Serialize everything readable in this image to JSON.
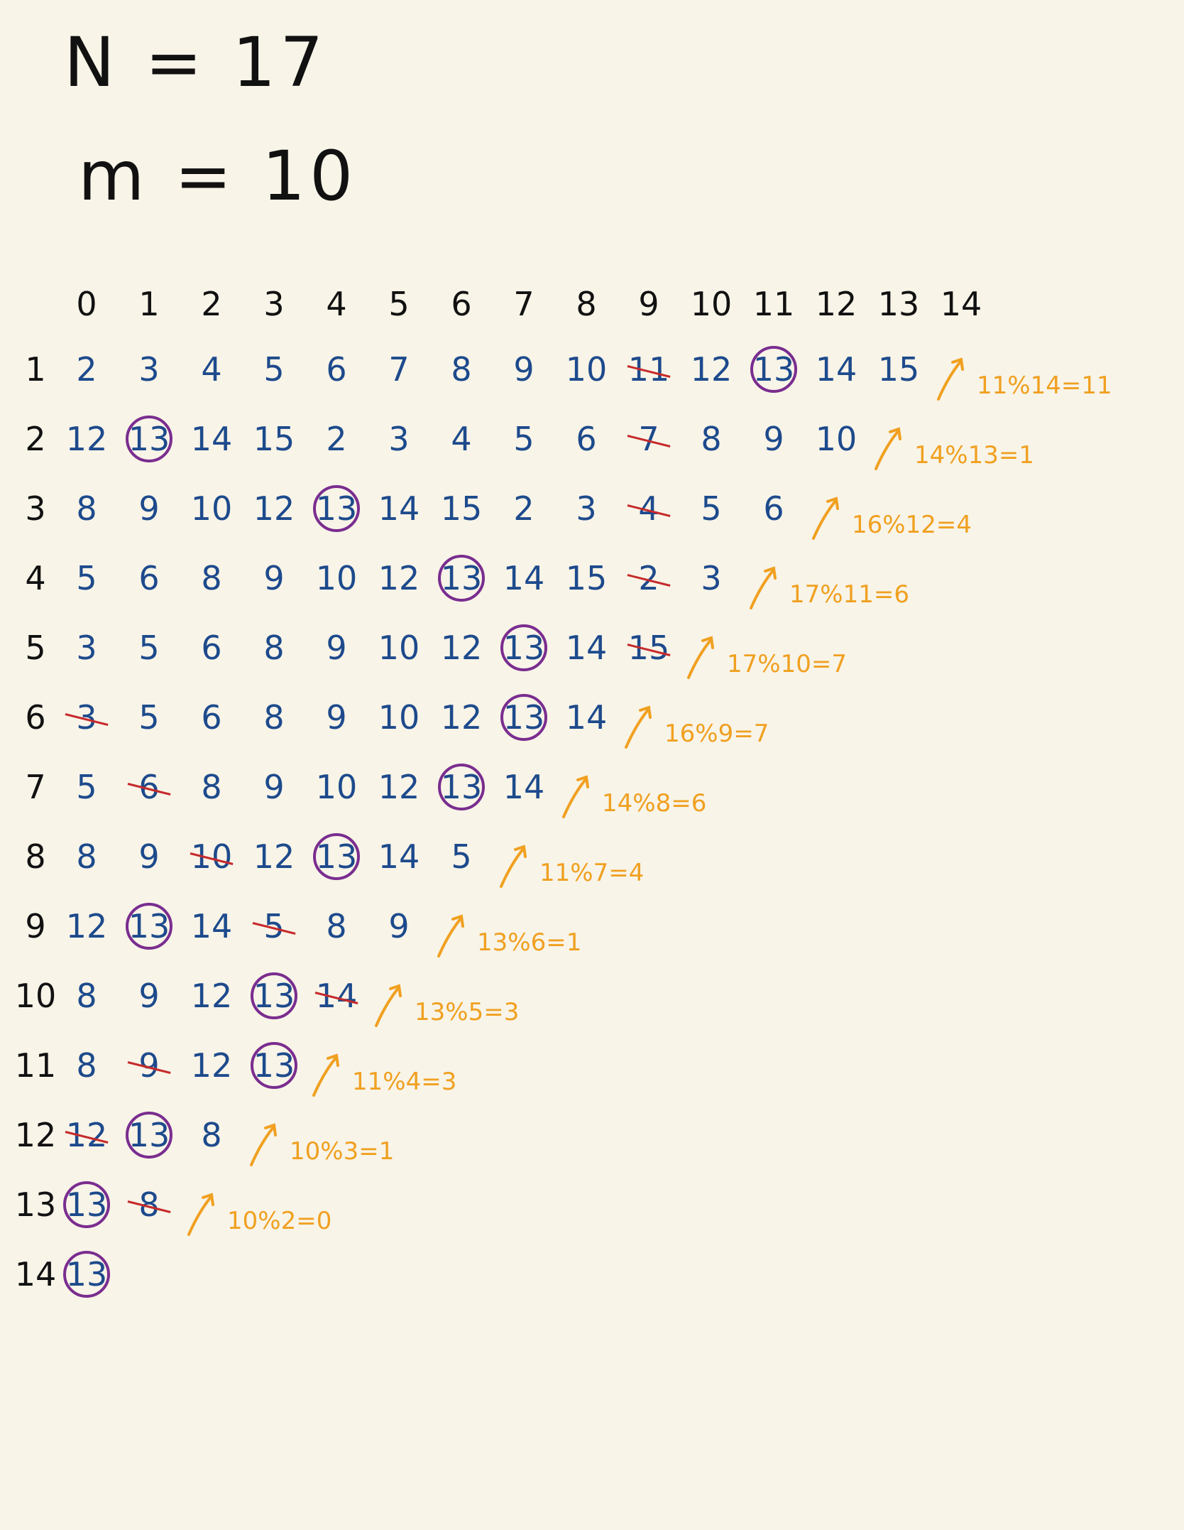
{
  "header": {
    "n_line": "N = 17",
    "m_line": "m = 10"
  },
  "colors": {
    "ink": "#111111",
    "cell": "#1d4a8c",
    "circle": "#7a2d8f",
    "strike": "#c62a2a",
    "note": "#f0a020"
  },
  "columns": [
    "0",
    "1",
    "2",
    "3",
    "4",
    "5",
    "6",
    "7",
    "8",
    "9",
    "10",
    "11",
    "12",
    "13",
    "14"
  ],
  "rows": [
    {
      "label": "1",
      "cells": [
        "2",
        "3",
        "4",
        "5",
        "6",
        "7",
        "8",
        "9",
        "10",
        "11",
        "12",
        "13",
        "14",
        "15"
      ],
      "circled": 11,
      "struck": 9,
      "note": "11%14=11"
    },
    {
      "label": "2",
      "cells": [
        "12",
        "13",
        "14",
        "15",
        "2",
        "3",
        "4",
        "5",
        "6",
        "7",
        "8",
        "9",
        "10"
      ],
      "circled": 1,
      "struck": 9,
      "note": "14%13=1"
    },
    {
      "label": "3",
      "cells": [
        "8",
        "9",
        "10",
        "12",
        "13",
        "14",
        "15",
        "2",
        "3",
        "4",
        "5",
        "6"
      ],
      "circled": 4,
      "struck": 9,
      "note": "16%12=4"
    },
    {
      "label": "4",
      "cells": [
        "5",
        "6",
        "8",
        "9",
        "10",
        "12",
        "13",
        "14",
        "15",
        "2",
        "3"
      ],
      "circled": 6,
      "struck": 9,
      "note": "17%11=6"
    },
    {
      "label": "5",
      "cells": [
        "3",
        "5",
        "6",
        "8",
        "9",
        "10",
        "12",
        "13",
        "14",
        "15"
      ],
      "circled": 7,
      "struck": 9,
      "note": "17%10=7"
    },
    {
      "label": "6",
      "cells": [
        "3",
        "5",
        "6",
        "8",
        "9",
        "10",
        "12",
        "13",
        "14"
      ],
      "circled": 7,
      "struck": 0,
      "note": "16%9=7"
    },
    {
      "label": "7",
      "cells": [
        "5",
        "6",
        "8",
        "9",
        "10",
        "12",
        "13",
        "14"
      ],
      "circled": 6,
      "struck": 1,
      "note": "14%8=6"
    },
    {
      "label": "8",
      "cells": [
        "8",
        "9",
        "10",
        "12",
        "13",
        "14",
        "5"
      ],
      "circled": 4,
      "struck": 2,
      "note": "11%7=4"
    },
    {
      "label": "9",
      "cells": [
        "12",
        "13",
        "14",
        "5",
        "8",
        "9"
      ],
      "circled": 1,
      "struck": 3,
      "note": "13%6=1"
    },
    {
      "label": "10",
      "cells": [
        "8",
        "9",
        "12",
        "13",
        "14"
      ],
      "circled": 3,
      "struck": 4,
      "note": "13%5=3"
    },
    {
      "label": "11",
      "cells": [
        "8",
        "9",
        "12",
        "13"
      ],
      "circled": 3,
      "struck": 1,
      "note": "11%4=3"
    },
    {
      "label": "12",
      "cells": [
        "12",
        "13",
        "8"
      ],
      "circled": 1,
      "struck": 0,
      "note": "10%3=1"
    },
    {
      "label": "13",
      "cells": [
        "13",
        "8"
      ],
      "circled": 0,
      "struck": 1,
      "note": "10%2=0"
    },
    {
      "label": "14",
      "cells": [
        "13"
      ],
      "circled": 0,
      "struck": -1,
      "note": ""
    }
  ]
}
